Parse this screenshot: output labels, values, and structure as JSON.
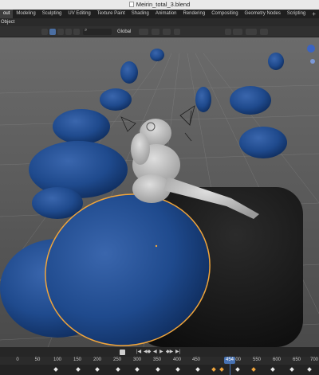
{
  "window": {
    "title": "Meirin_total_3.blend"
  },
  "workspace_tabs": [
    "out",
    "Modeling",
    "Sculpting",
    "UV Editing",
    "Texture Paint",
    "Shading",
    "Animation",
    "Rendering",
    "Compositing",
    "Geometry Nodes",
    "Scripting"
  ],
  "active_tab_index": 0,
  "add_tab_label": "+",
  "header": {
    "mode_label": "Object"
  },
  "toolbar": {
    "orientation_label": "Global"
  },
  "playback": {
    "jump_start": "|◀",
    "prev_key": "◀◆",
    "play_reverse": "◀",
    "play": "▶",
    "next_key": "◆▶",
    "jump_end": "▶|"
  },
  "timeline": {
    "ticks": [
      "0",
      "50",
      "100",
      "150",
      "200",
      "250",
      "300",
      "350",
      "400",
      "450",
      "500",
      "550",
      "600",
      "650",
      "700"
    ],
    "current_frame": "454"
  },
  "colors": {
    "sculpt_blue": "#1e4a8c",
    "selection_outline": "#f0a53c",
    "frame_accent": "#4772b3"
  }
}
